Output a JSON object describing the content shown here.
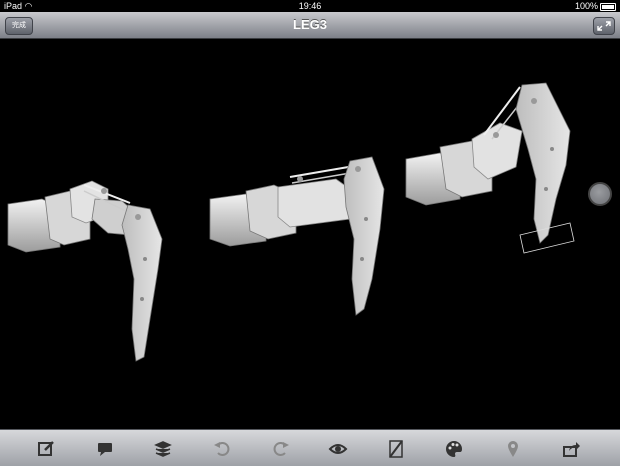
{
  "status": {
    "device": "iPad",
    "time": "19:46",
    "battery": "100%",
    "battery_level": 1.0
  },
  "nav": {
    "title": "LEG3",
    "done_label": "完成"
  },
  "toolbar": {
    "tools": [
      "edit-note-icon",
      "comment-icon",
      "layers-icon",
      "undo-icon",
      "redo-icon",
      "view-eye-icon",
      "section-icon",
      "palette-icon",
      "location-pin-icon",
      "share-icon"
    ]
  },
  "colors": {
    "model": "#d8d8d8",
    "background": "#000000",
    "toolbar": "#c3c5c9"
  }
}
